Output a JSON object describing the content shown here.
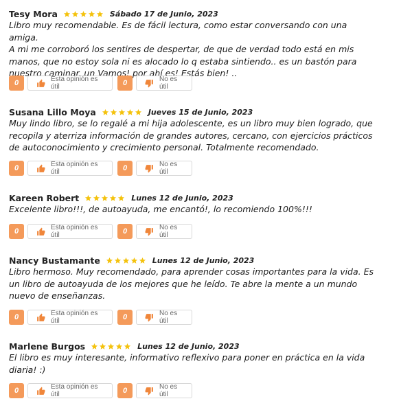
{
  "reviews": [
    {
      "name": "Tesy Mora",
      "rating": 5,
      "date": "Sábado 17 de Junio, 2023",
      "lines": [
        "Libro muy recomendable. Es de fácil lectura, como estar conversando con una amiga.",
        "A mi me corroboró los sentires de despertar, de que de verdad todo está en mis",
        "manos, que no estoy sola ni es alocado lo q estaba sintiendo.. es un bastón para",
        "nuestro caminar, un Vamos! por ahí es! Estás bien! .."
      ],
      "useful_count": "0",
      "not_useful_count": "0"
    },
    {
      "name": "Susana Lillo Moya",
      "rating": 5,
      "date": "Jueves 15 de Junio, 2023",
      "lines": [
        "Muy lindo libro, se lo regalé a mi hija adolescente, es un libro muy bien logrado, que",
        "recopila y aterriza información de grandes autores, cercano, con ejercicios prácticos",
        "de autoconocimiento y crecimiento personal. Totalmente recomendado."
      ],
      "useful_count": "0",
      "not_useful_count": "0"
    },
    {
      "name": "Kareen Robert",
      "rating": 5,
      "date": "Lunes 12 de Junio, 2023",
      "lines": [
        "Excelente libro!!!, de autoayuda, me encantó!, lo recomiendo 100%!!!"
      ],
      "useful_count": "0",
      "not_useful_count": "0"
    },
    {
      "name": "Nancy Bustamante",
      "rating": 5,
      "date": "Lunes 12 de Junio, 2023",
      "lines": [
        "Libro hermoso. Muy recomendado, para aprender cosas importantes para la vida. Es",
        "un libro de autoayuda de los mejores que he leído. Te abre la mente a un mundo",
        "nuevo de enseñanzas."
      ],
      "useful_count": "0",
      "not_useful_count": "0"
    },
    {
      "name": "Marlene Burgos",
      "rating": 5,
      "date": "Lunes 12 de Junio, 2023",
      "lines": [
        "El libro es muy interesante, informativo reflexivo para poner en práctica en la vida",
        "diaria! :)"
      ],
      "useful_count": "0",
      "not_useful_count": "0"
    }
  ],
  "labels": {
    "useful": "Esta opinión es útil",
    "not_useful": "No es útil"
  },
  "icons": {
    "star": "star-icon",
    "thumb_up": "thumbs-up-icon",
    "thumb_down": "thumbs-down-icon"
  },
  "colors": {
    "star": "#f4c20d",
    "accent": "#f49a5a",
    "icon": "#f0863a"
  }
}
